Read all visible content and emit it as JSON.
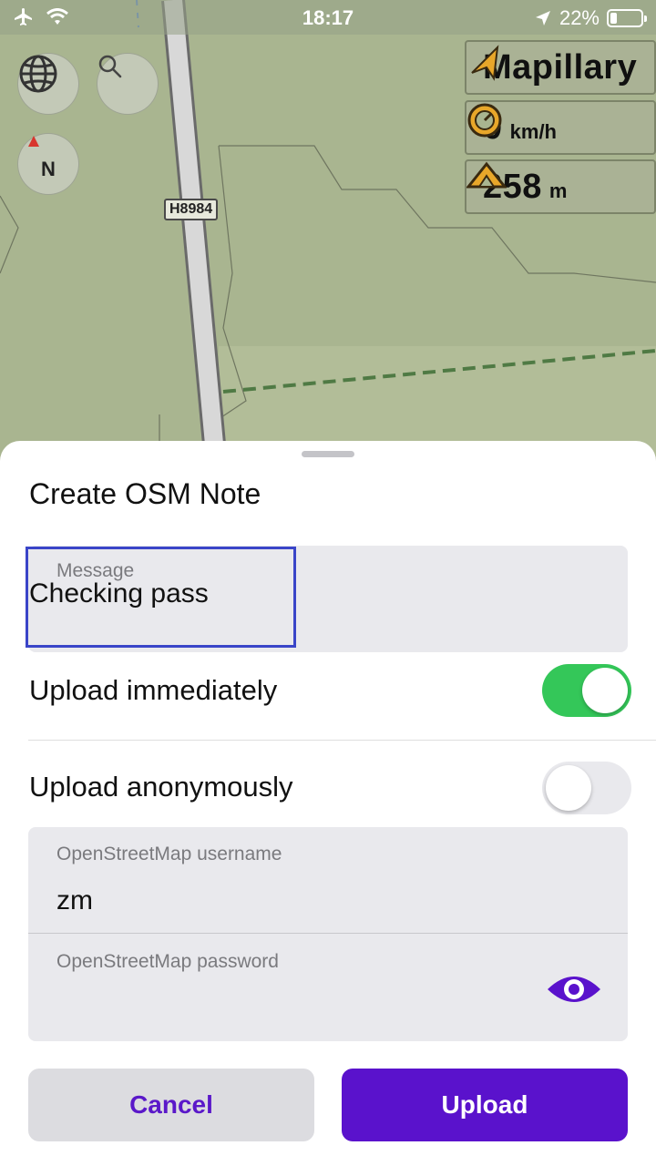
{
  "status_bar": {
    "time": "18:17",
    "battery_text": "22%",
    "battery_level": 0.22
  },
  "map": {
    "road_label": "H8984",
    "widgets": {
      "mapillary": "Mapillary",
      "speed_value": "0",
      "speed_unit": "km/h",
      "altitude_value": "258",
      "altitude_unit": "m"
    },
    "compass_letter": "N"
  },
  "sheet": {
    "title": "Create OSM Note",
    "message": {
      "label": "Message",
      "value": "Checking pass"
    },
    "upload_immediately": {
      "label": "Upload immediately",
      "on": true
    },
    "upload_anonymously": {
      "label": "Upload anonymously",
      "on": false
    },
    "username": {
      "label": "OpenStreetMap username",
      "value": "zm"
    },
    "password": {
      "label": "OpenStreetMap password",
      "value": ""
    },
    "cancel_label": "Cancel",
    "upload_label": "Upload"
  },
  "colors": {
    "accent": "#5a12cc",
    "toggle_on": "#34c759",
    "toggle_off": "#e9e9ed",
    "focus": "#3a45c8"
  }
}
